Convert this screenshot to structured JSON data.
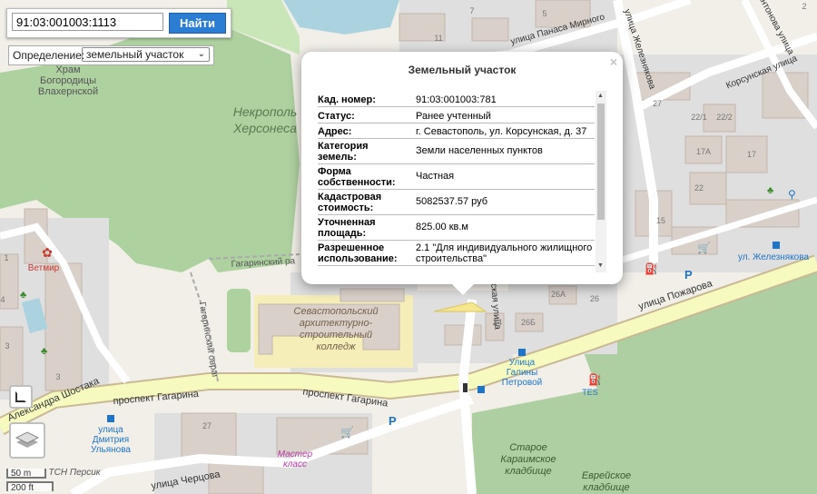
{
  "search": {
    "value": "91:03:001003:1113",
    "button_label": "Найти"
  },
  "definition": {
    "label": "Определение:",
    "selected": "земельный участок"
  },
  "popup": {
    "title": "Земельный участок",
    "close": "×",
    "rows": [
      {
        "key": "Кад. номер:",
        "value": "91:03:001003:781"
      },
      {
        "key": "Статус:",
        "value": "Ранее учтенный"
      },
      {
        "key": "Адрес:",
        "value": "г. Севастополь, ул. Корсунская, д. 37"
      },
      {
        "key": "Категория земель:",
        "value": "Земли населенных пунктов"
      },
      {
        "key": "Форма собственности:",
        "value": "Частная"
      },
      {
        "key": "Кадастровая стоимость:",
        "value": "5082537.57 руб"
      },
      {
        "key": "Уточненная площадь:",
        "value": "825.00 кв.м"
      },
      {
        "key": "Разрешенное использование:",
        "value": "2.1 \"Для индивидуального жилищного строительства\""
      }
    ]
  },
  "scale": {
    "metric": "50 m",
    "imperial": "200 ft"
  },
  "map": {
    "labels": {
      "temple": [
        "Храм",
        "Богородицы",
        "Влахернской"
      ],
      "necropolis": [
        "Некрополь",
        "Херсонеса"
      ],
      "vetmir": "Ветмир",
      "gagarin_road": "Гагаринский ра",
      "gagarin_ovrag": "Гагаринский овраг",
      "college": [
        "Севастопольский",
        "архитектурно-",
        "строительный",
        "колледж"
      ],
      "shostaka": "Александра Шостака",
      "gagarin_ave1": "проспект Гагарина",
      "gagarin_ave2": "проспект Гагарина",
      "ulyanova": [
        "улица",
        "Дмитрия",
        "Ульянова"
      ],
      "chertsova": "улица Черцова",
      "tsn": "ТСН Персик",
      "master": [
        "Мастер",
        "класс"
      ],
      "karaim": [
        "Старое",
        "Караимское",
        "кладбище"
      ],
      "jewish": [
        "Еврейское",
        "кладбище"
      ],
      "galina": [
        "Улица",
        "Галины",
        "Петровой"
      ],
      "pozharova": "улица Пожарова",
      "zheleznyakova_stop": "ул. Железнякова",
      "zheleznyakova": "улица Железнякова",
      "panasa": "улица Панаса Мирного",
      "korsunskaya": "Корсунская улица",
      "antonova": "Антонова улица",
      "korsunskaya2": "нская улица",
      "tes": "TES"
    },
    "house_numbers": [
      "27",
      "22/1",
      "22/2",
      "17А",
      "17",
      "22",
      "15",
      "26",
      "26А",
      "26Б",
      "24",
      "3",
      "4",
      "1",
      "27",
      "3",
      "5",
      "7",
      "11",
      "2"
    ]
  }
}
